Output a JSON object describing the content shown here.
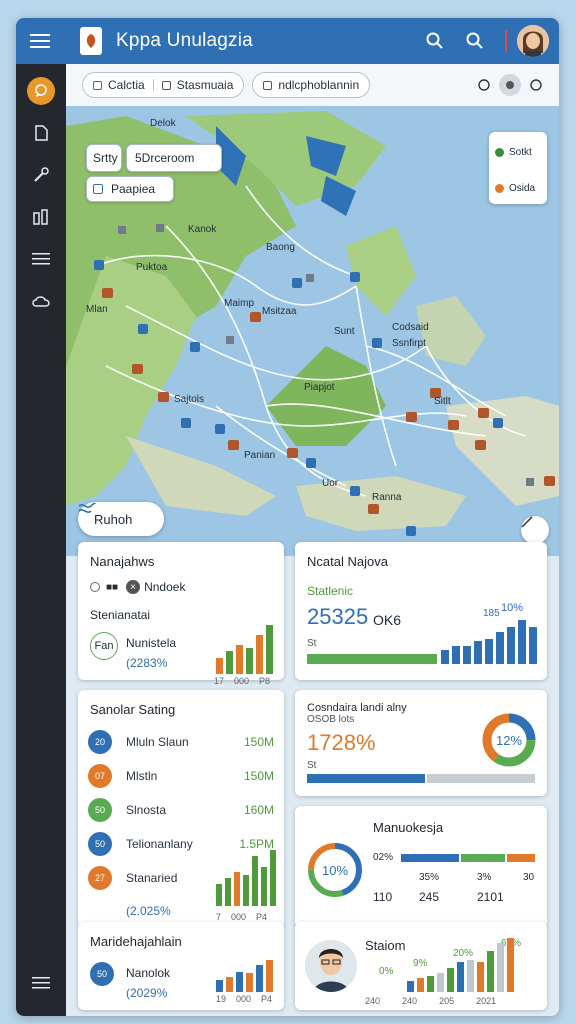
{
  "app": {
    "title": "Kppa Unulagzia"
  },
  "filters": {
    "chip1_label_a": "Calctia",
    "chip1_label_b": "Stasmuaia",
    "chip2_label": "ndlcphoblannin"
  },
  "map": {
    "search_value": "Srtty",
    "search_option": "5Drceroom",
    "search_result": "Paapiea",
    "legend": [
      {
        "label": "Sotkt",
        "color": "#3a8b3c"
      },
      {
        "label": "Osida",
        "color": "#e07a2a"
      }
    ],
    "region_button": "Ruhoh",
    "labels": {
      "l1": "Delok",
      "l2": "Baong",
      "l3": "Kanok",
      "l4": "Puktoa",
      "l5": "Mlan",
      "l6": "Maimp",
      "l7": "Msitzaa",
      "l8": "Sunt",
      "l9": "Codsaid",
      "l10": "Ssnfirpt",
      "l11": "Sajtols",
      "l12": "Piapjot",
      "l13": "Panian",
      "l14": "Uor",
      "l15": "Ranna",
      "l16": "Sitlt"
    }
  },
  "card1": {
    "title": "Nanajahws",
    "toggle_label": "Nndoek",
    "subtitle": "Stenianatai",
    "badge": "Fan",
    "metric_label": "Nunistela",
    "metric_value": "(2283%",
    "axis": [
      "17",
      "000",
      "P8"
    ],
    "bars": [
      {
        "v": 0.3,
        "c": "#e07a2a"
      },
      {
        "v": 0.45,
        "c": "#4f9a3a"
      },
      {
        "v": 0.55,
        "c": "#e07a2a"
      },
      {
        "v": 0.5,
        "c": "#4f9a3a"
      },
      {
        "v": 0.75,
        "c": "#e07a2a"
      },
      {
        "v": 0.95,
        "c": "#4f9a3a"
      }
    ]
  },
  "card2": {
    "title": "Ncatal Najova",
    "subtitle": "Statlenic",
    "big_value": "25325",
    "unit": "OK6",
    "small_label": "St",
    "pct_top": "10%",
    "pct_mid": "185",
    "bars": [
      0.3,
      0.4,
      0.4,
      0.5,
      0.55,
      0.7,
      0.8,
      0.95,
      0.8
    ]
  },
  "card3": {
    "title": "Sanolar Sating",
    "rows": [
      {
        "badge": "20",
        "color": "#2f6fb4",
        "label": "Mluln Slaun",
        "value": "150M"
      },
      {
        "badge": "07",
        "color": "#e07a2a",
        "label": "Mlstln",
        "value": "150M"
      },
      {
        "badge": "50",
        "color": "#5aaa52",
        "label": "Slnosta",
        "value": "160M"
      },
      {
        "badge": "50",
        "color": "#2f6fb4",
        "label": "Telionanlany",
        "value": "1.5PM"
      },
      {
        "badge": "27",
        "color": "#e07a2a",
        "label": "Stanaried",
        "value": ""
      }
    ],
    "metric_value": "(2.025%",
    "axis": [
      "7",
      "000",
      "P4"
    ],
    "bars": [
      {
        "v": 0.4,
        "c": "#4f9a3a"
      },
      {
        "v": 0.5,
        "c": "#4f9a3a"
      },
      {
        "v": 0.6,
        "c": "#e07a2a"
      },
      {
        "v": 0.55,
        "c": "#4f9a3a"
      },
      {
        "v": 0.9,
        "c": "#4f9a3a"
      },
      {
        "v": 0.7,
        "c": "#4f9a3a"
      },
      {
        "v": 1.0,
        "c": "#4f9a3a"
      }
    ]
  },
  "card4": {
    "label_line1": "Cosndaira landi alny",
    "label_line2": "OSOB lots",
    "big_value": "1728%",
    "small_label": "St",
    "donut_label": "12%",
    "donut": [
      {
        "frac": 0.25,
        "color": "#2f6fb4"
      },
      {
        "frac": 0.35,
        "color": "#5aaa52"
      },
      {
        "frac": 0.4,
        "color": "#e07a2a"
      }
    ]
  },
  "card5": {
    "title": "Manuokesja",
    "donut_label": "10%",
    "row1": [
      "02%",
      "",
      ""
    ],
    "row2": [
      "",
      "35%",
      "3%",
      "30"
    ],
    "row3": [
      "110",
      "245",
      "2101"
    ],
    "donut": [
      {
        "frac": 0.45,
        "color": "#2f6fb4"
      },
      {
        "frac": 0.3,
        "color": "#5aaa52"
      },
      {
        "frac": 0.25,
        "color": "#e07a2a"
      }
    ]
  },
  "card6": {
    "title": "Maridehajahlain",
    "badge": "50",
    "metric_label": "Nanolok",
    "metric_value": "(2029%",
    "axis": [
      "19",
      "000",
      "P4"
    ],
    "bars": [
      {
        "v": 0.35,
        "c": "#2f6fb4"
      },
      {
        "v": 0.45,
        "c": "#e07a2a"
      },
      {
        "v": 0.6,
        "c": "#2f6fb4"
      },
      {
        "v": 0.55,
        "c": "#e07a2a"
      },
      {
        "v": 0.8,
        "c": "#2f6fb4"
      },
      {
        "v": 0.95,
        "c": "#e07a2a"
      }
    ]
  },
  "card7": {
    "title": "Staiom",
    "pct_labels": [
      "0%",
      "9%",
      "20%",
      "60%"
    ],
    "axis": [
      "240",
      "240",
      "205",
      "2021"
    ],
    "bars": [
      {
        "v": 0.2,
        "c": "#2f6fb4"
      },
      {
        "v": 0.25,
        "c": "#e07a2a"
      },
      {
        "v": 0.3,
        "c": "#4f9a3a"
      },
      {
        "v": 0.35,
        "c": "#bfc7cf"
      },
      {
        "v": 0.45,
        "c": "#4f9a3a"
      },
      {
        "v": 0.55,
        "c": "#2f6fb4"
      },
      {
        "v": 0.6,
        "c": "#bfc7cf"
      },
      {
        "v": 0.55,
        "c": "#e07a2a"
      },
      {
        "v": 0.75,
        "c": "#4f9a3a"
      },
      {
        "v": 0.9,
        "c": "#bfc7cf"
      },
      {
        "v": 1.0,
        "c": "#e07a2a"
      }
    ]
  }
}
